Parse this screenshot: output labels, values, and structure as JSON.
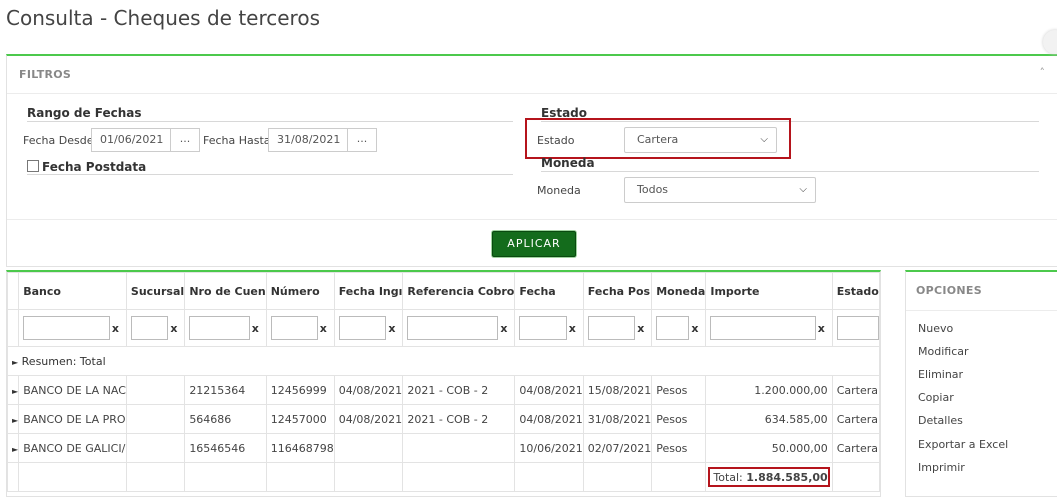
{
  "page": {
    "title": "Consulta - Cheques de terceros"
  },
  "filters": {
    "title": "FILTROS",
    "date_range": {
      "section": "Rango de Fechas",
      "from_label": "Fecha Desde",
      "from_value": "01/06/2021",
      "to_label": "Fecha Hasta",
      "to_value": "31/08/2021",
      "picker": "...",
      "postdated_label": "Fecha Postdata"
    },
    "estado": {
      "section": "Estado",
      "label": "Estado",
      "value": "Cartera"
    },
    "moneda": {
      "section": "Moneda",
      "label": "Moneda",
      "value": "Todos"
    },
    "apply_label": "APLICAR"
  },
  "grid": {
    "columns": [
      "Banco",
      "Sucursal",
      "Nro de Cuen",
      "Número",
      "Fecha Ingı",
      "Referencia Cobro",
      "Fecha",
      "Fecha Pos",
      "Moneda",
      "Importe",
      "Estado"
    ],
    "clear_symbol": "x",
    "summary_label": "Resumen: Total",
    "rows": [
      {
        "banco": "BANCO DE LA NAC",
        "sucursal": "",
        "cuenta": "21215364",
        "numero": "12456999",
        "fecha_ing": "04/08/2021",
        "referencia": "2021 - COB - 2",
        "fecha": "04/08/2021",
        "fecha_pos": "15/08/2021",
        "moneda": "Pesos",
        "importe": "1.200.000,00",
        "estado": "Cartera"
      },
      {
        "banco": "BANCO DE LA PRO",
        "sucursal": "",
        "cuenta": "564686",
        "numero": "12457000",
        "fecha_ing": "04/08/2021",
        "referencia": "2021 - COB - 2",
        "fecha": "04/08/2021",
        "fecha_pos": "31/08/2021",
        "moneda": "Pesos",
        "importe": "634.585,00",
        "estado": "Cartera"
      },
      {
        "banco": "BANCO DE GALICI/",
        "sucursal": "",
        "cuenta": "16546546",
        "numero": "116468798",
        "fecha_ing": "",
        "referencia": "",
        "fecha": "10/06/2021",
        "fecha_pos": "02/07/2021",
        "moneda": "Pesos",
        "importe": "50.000,00",
        "estado": "Cartera"
      }
    ],
    "total_label": "Total:",
    "total_value": "1.884.585,00"
  },
  "options": {
    "title": "OPCIONES",
    "items": [
      "Nuevo",
      "Modificar",
      "Eliminar",
      "Copiar",
      "Detalles",
      "Exportar a Excel",
      "Imprimir"
    ]
  },
  "colors": {
    "accent_green": "#4cc94c",
    "apply_button": "#146c1c",
    "highlight_red": "#b5141c"
  }
}
